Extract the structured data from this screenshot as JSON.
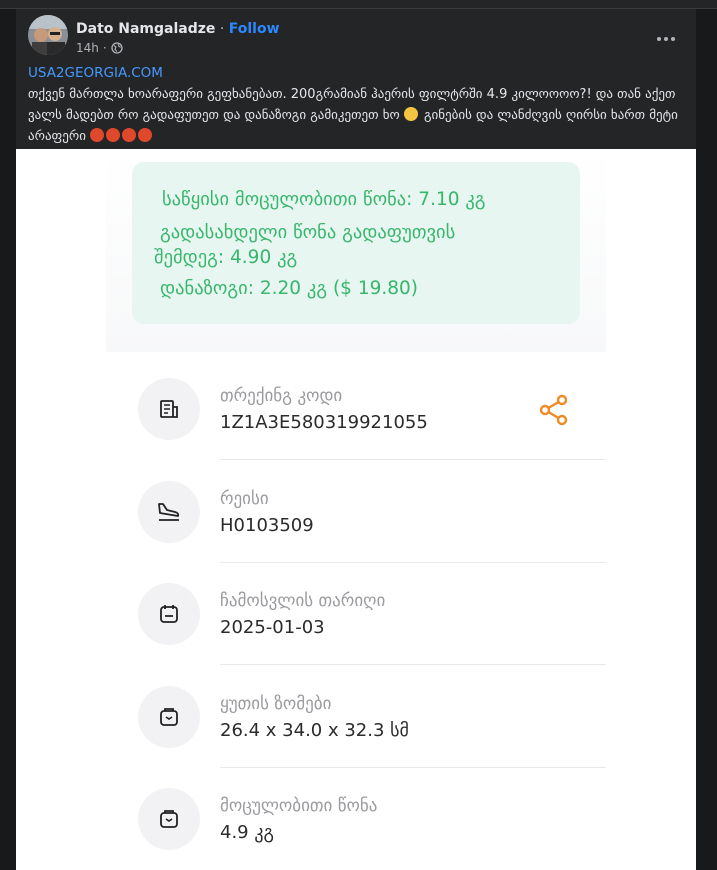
{
  "post": {
    "author": "Dato Namgaladze",
    "separator": " · ",
    "follow_label": "Follow",
    "time": "14h",
    "link": "USA2GEORGIA.COM",
    "text_part1": "თქვენ მართლა ხოარაფერი გეფხანებათ. 200გრამიან ჰაერის ფილტრში 4.9 კილოოოო?! და თან აქეთ ვალს მადებთ რო გადაფუთეთ და დანაზოგი გამიკეთეთ ხო",
    "text_part2": "გინების და ლანძღვის ღირსი ხართ მეტი არაფერი"
  },
  "shipment": {
    "bubble": {
      "line1": "საწყისი მოცულობითი წონა: 7.10 კგ",
      "line2": " გადასახდელი წონა გადაფუთვის",
      "line3": "შემდეგ: 4.90 კგ",
      "line4": " დანაზოგი: 2.20 კგ ($ 19.80)"
    },
    "rows": [
      {
        "label": "თრექინგ კოდი",
        "value": "1Z1A3E580319921055",
        "icon": "tracking-icon"
      },
      {
        "label": "რეისი",
        "value": "H0103509",
        "icon": "flight-landing-icon"
      },
      {
        "label": "ჩამოსვლის თარიღი",
        "value": "2025-01-03",
        "icon": "calendar-icon"
      },
      {
        "label": "ყუთის ზომები",
        "value": "26.4 x 34.0 x 32.3 სმ",
        "icon": "box-dimensions-icon"
      },
      {
        "label": "მოცულობითი წონა",
        "value": "4.9 კგ",
        "icon": "weight-icon"
      }
    ]
  },
  "colors": {
    "accent_link": "#4599ff",
    "follow": "#2d88ff",
    "bubble_text": "#37b66c",
    "share_icon": "#f08a24"
  }
}
